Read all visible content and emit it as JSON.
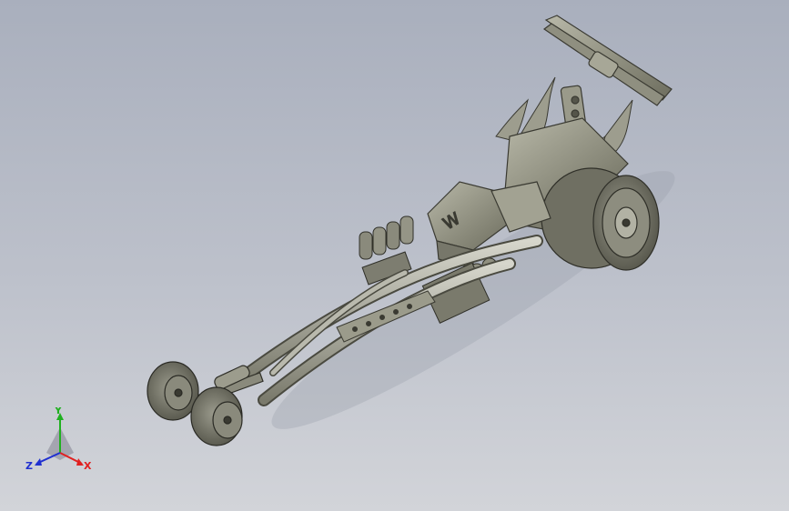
{
  "viewport": {
    "background_top": "#a9afbd",
    "background_bottom": "#d2d4d9",
    "model_color": "#8c8c7a"
  },
  "model": {
    "name": "dragster-car-model"
  },
  "triad": {
    "x_label": "X",
    "y_label": "Y",
    "z_label": "Z",
    "x_color": "#e02020",
    "y_color": "#20b020",
    "z_color": "#2030d0"
  }
}
